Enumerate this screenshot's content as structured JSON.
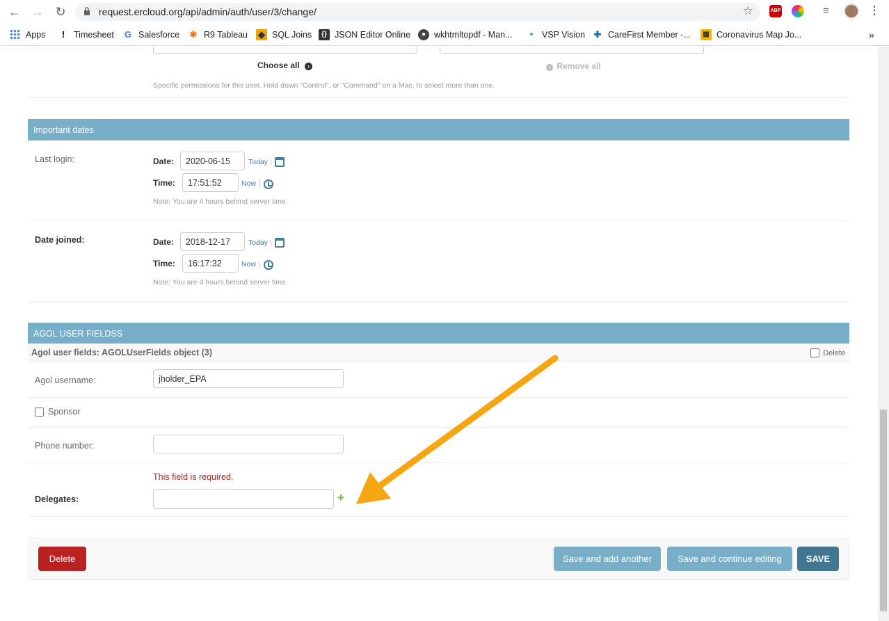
{
  "browser": {
    "url": "request.ercloud.org/api/admin/auth/user/3/change/",
    "bookmarks": [
      "Apps",
      "Timesheet",
      "Salesforce",
      "R9 Tableau",
      "SQL Joins",
      "JSON Editor Online",
      "wkhtmltopdf - Man...",
      "VSP Vision",
      "CareFirst Member -...",
      "Coronavirus Map Jo..."
    ],
    "more": "»"
  },
  "permissions": {
    "choose_all": "Choose all",
    "remove_all": "Remove all",
    "help": "Specific permissions for this user. Hold down \"Control\", or \"Command\" on a Mac, to select more than one."
  },
  "important_dates": {
    "title": "Important dates",
    "last_login": {
      "label": "Last login:",
      "date_label": "Date:",
      "date": "2020-06-15",
      "today": "Today",
      "time_label": "Time:",
      "time": "17:51:52",
      "now": "Now",
      "note": "Note: You are 4 hours behind server time."
    },
    "date_joined": {
      "label": "Date joined:",
      "date_label": "Date:",
      "date": "2018-12-17",
      "today": "Today",
      "time_label": "Time:",
      "time": "16:17:32",
      "now": "Now",
      "note": "Note: You are 4 hours behind server time."
    }
  },
  "agol": {
    "title": "AGOL USER FIELDSS",
    "object_title": "Agol user fields: AGOLUserFields object (3)",
    "delete_label": "Delete",
    "username_label": "Agol username:",
    "username_value": "jholder_EPA",
    "sponsor_label": "Sponsor",
    "phone_label": "Phone number:",
    "phone_value": "",
    "error": "This field is required.",
    "delegates_label": "Delegates:",
    "delegates_value": ""
  },
  "submit": {
    "delete": "Delete",
    "save_add": "Save and add another",
    "save_continue": "Save and continue editing",
    "save": "SAVE"
  },
  "colors": {
    "module_header": "#79aec8",
    "save_button": "#417690",
    "delete_button": "#ba2121",
    "error_text": "#ba2121",
    "annotation_arrow": "#f5a611"
  }
}
